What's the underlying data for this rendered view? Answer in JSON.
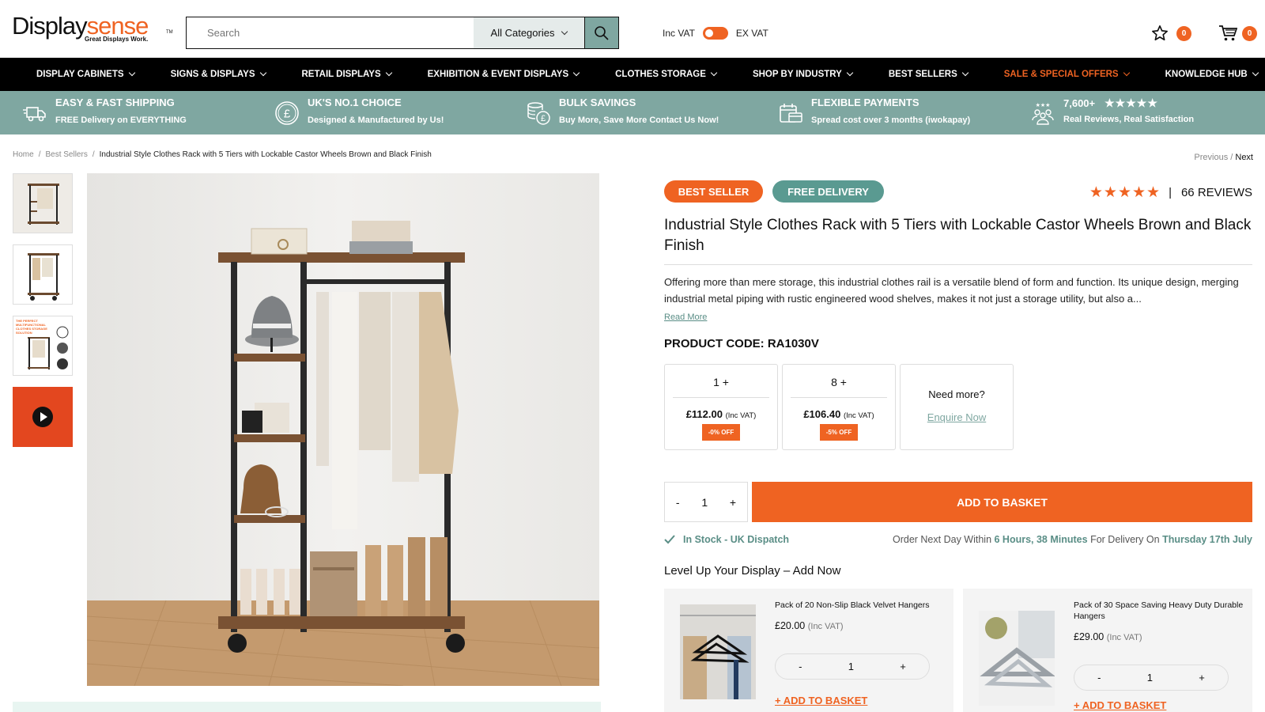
{
  "header": {
    "logo_dark": "Display",
    "logo_orange": "sense",
    "logo_tagline": "Great Displays Work.",
    "logo_tm": "TM",
    "search_placeholder": "Search",
    "category_select": "All Categories",
    "vat_inc": "Inc VAT",
    "vat_ex": "EX VAT",
    "wishlist_count": "0",
    "cart_count": "0"
  },
  "nav": {
    "items": [
      "DISPLAY CABINETS",
      "SIGNS & DISPLAYS",
      "RETAIL DISPLAYS",
      "EXHIBITION & EVENT DISPLAYS",
      "CLOTHES STORAGE",
      "SHOP BY INDUSTRY",
      "BEST SELLERS",
      "SALE & SPECIAL OFFERS",
      "KNOWLEDGE HUB"
    ]
  },
  "usp": [
    {
      "title": "EASY & FAST SHIPPING",
      "sub": "FREE Delivery on EVERYTHING",
      "icon": "truck-icon"
    },
    {
      "title": "UK'S NO.1 CHOICE",
      "sub": "Designed & Manufactured by Us!",
      "icon": "pound-coin-icon"
    },
    {
      "title": "BULK SAVINGS",
      "sub": "Buy More, Save More Contact Us Now!",
      "icon": "coins-stack-icon"
    },
    {
      "title": "FLEXIBLE PAYMENTS",
      "sub": "Spread cost over 3 months (iwokapay)",
      "icon": "calendar-card-icon"
    },
    {
      "title": "7,600+",
      "sub": "Real Reviews, Real Satisfaction",
      "icon": "people-stars-icon",
      "stars": "★★★★★"
    }
  ],
  "breadcrumb": {
    "home": "Home",
    "category": "Best Sellers",
    "current": "Industrial Style Clothes Rack with 5 Tiers with Lockable Castor Wheels Brown and Black Finish",
    "sep": "/",
    "previous": "Previous",
    "next": "Next"
  },
  "thumbs": {
    "promo_text": "THE PERFECT MULTIFUNCTIONAL CLOTHES STORAGE SOLUTION"
  },
  "product": {
    "badge_best": "BEST SELLER",
    "badge_free": "FREE DELIVERY",
    "rating_stars": "★★★★★",
    "rating_sep": "|",
    "reviews": "66 REVIEWS",
    "title": "Industrial Style Clothes Rack with 5 Tiers with Lockable Castor Wheels Brown and Black Finish",
    "description": "Offering more than mere storage, this industrial clothes rail is a versatile blend of form and function. Its unique design, merging industrial metal piping with rustic engineered wood shelves, makes it not just a storage utility, but also a...",
    "read_more": "Read More",
    "code": "PRODUCT CODE: RA1030V",
    "tiers": [
      {
        "qty": "1 +",
        "price": "£112.00",
        "vat": "(Inc VAT)",
        "off": "-0% OFF"
      },
      {
        "qty": "8 +",
        "price": "£106.40",
        "vat": "(Inc VAT)",
        "off": "-5% OFF"
      }
    ],
    "need_more": "Need more?",
    "enquire": "Enquire Now",
    "minus": "-",
    "qty": "1",
    "plus": "+",
    "add_basket": "ADD TO BASKET",
    "stock": "In Stock - UK Dispatch",
    "delivery_pre": "Order Next Day Within ",
    "delivery_time": "6 Hours, 38 Minutes",
    "delivery_mid": " For Delivery On ",
    "delivery_date": "Thursday 17th July",
    "levelup": "Level Up Your Display – Add Now"
  },
  "upsells": [
    {
      "name": "Pack of 20 Non-Slip Black Velvet Hangers",
      "price": "£20.00",
      "vat": "(Inc VAT)",
      "qty": "1",
      "minus": "-",
      "plus": "+",
      "add": "+ ADD TO BASKET"
    },
    {
      "name": "Pack of 30 Space Saving Heavy Duty Durable Hangers",
      "price": "£29.00",
      "vat": "(Inc VAT)",
      "qty": "1",
      "minus": "-",
      "plus": "+",
      "add": "+ ADD TO BASKET"
    }
  ],
  "colors": {
    "accent_orange": "#ef6322",
    "teal": "#7fa7a1",
    "teal_dark": "#5a8e86"
  }
}
